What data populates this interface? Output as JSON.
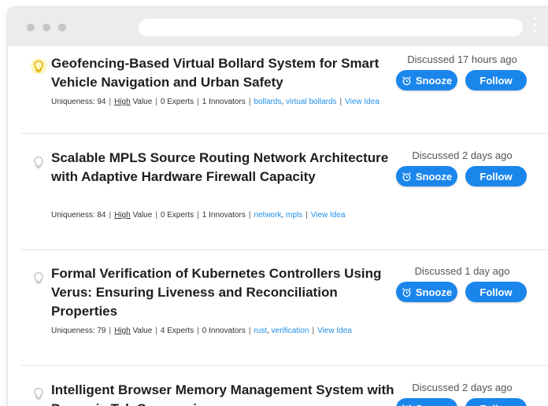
{
  "browser": {
    "url": ""
  },
  "ideas": [
    {
      "title": "Geofencing-Based Virtual Bollard System for Smart Vehicle Navigation and Urban Safety",
      "discussed": "Discussed 17 hours ago",
      "uniqueness": "Uniqueness: 94",
      "value_level": "High",
      "value_suffix": " Value",
      "experts": "0 Experts",
      "innovators": "1 Innovators",
      "tags": [
        "bollards",
        "virtual bollards"
      ],
      "view_label": "View Idea",
      "bulb_active": true
    },
    {
      "title": "Scalable MPLS Source Routing Network Architecture with Adaptive Hardware Firewall Capacity",
      "discussed": "Discussed 2 days ago",
      "uniqueness": "Uniqueness: 84",
      "value_level": "High",
      "value_suffix": " Value",
      "experts": "0 Experts",
      "innovators": "1 Innovators",
      "tags": [
        "network",
        "mpls"
      ],
      "view_label": "View Idea",
      "bulb_active": false
    },
    {
      "title": "Formal Verification of Kubernetes Controllers Using Verus: Ensuring Liveness and Reconciliation Properties",
      "discussed": "Discussed 1 day ago",
      "uniqueness": "Uniqueness: 79",
      "value_level": "High",
      "value_suffix": " Value",
      "experts": "4 Experts",
      "innovators": "0 Innovators",
      "tags": [
        "rust",
        "verification"
      ],
      "view_label": "View Idea",
      "bulb_active": false
    },
    {
      "title": "Intelligent Browser Memory Management System with Dynamic Tab Suspension",
      "discussed": "Discussed 2 days ago",
      "bulb_active": false
    }
  ],
  "actions": {
    "snooze_label": "Snooze",
    "follow_label": "Follow"
  },
  "icons": {
    "bulb_active": "lightbulb-icon",
    "bulb_inactive": "lightbulb-outline-icon",
    "snooze": "alarm-clock-icon"
  },
  "colors": {
    "accent": "#1a86ec",
    "link": "#1f8ee8",
    "bulb_active": "#f2c200"
  }
}
